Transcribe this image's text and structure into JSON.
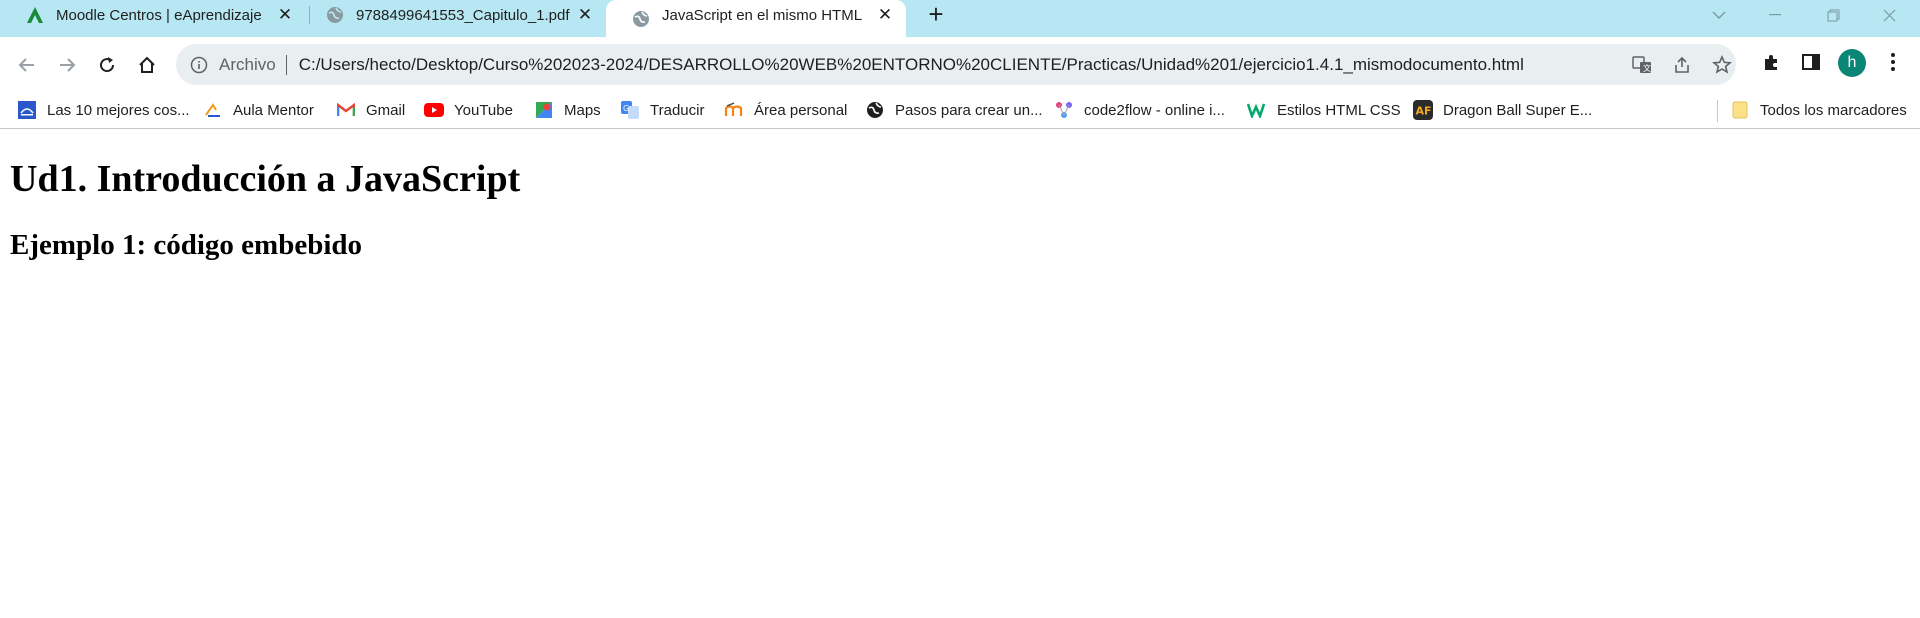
{
  "tabs": [
    {
      "title": "Moodle Centros | eAprendizaje",
      "icon": "moodle-icon"
    },
    {
      "title": "9788499641553_Capitulo_1.pdf",
      "icon": "globe-icon"
    },
    {
      "title": "JavaScript en el mismo HTML",
      "icon": "globe-icon",
      "active": true
    }
  ],
  "toolbar": {
    "scheme_label": "Archivo",
    "url": "C:/Users/hecto/Desktop/Curso%202023-2024/DESARROLLO%20WEB%20ENTORNO%20CLIENTE/Practicas/Unidad%201/ejercicio1.4.1_mismodocumento.html",
    "avatar_letter": "h"
  },
  "bookmarks": [
    {
      "label": "Las 10 mejores cos...",
      "icon": "bookmark-site-icon"
    },
    {
      "label": "Aula Mentor",
      "icon": "aula-mentor-icon"
    },
    {
      "label": "Gmail",
      "icon": "gmail-icon"
    },
    {
      "label": "YouTube",
      "icon": "youtube-icon"
    },
    {
      "label": "Maps",
      "icon": "maps-icon"
    },
    {
      "label": "Traducir",
      "icon": "translate-icon"
    },
    {
      "label": "Área personal",
      "icon": "moodle-m-icon"
    },
    {
      "label": "Pasos para crear un...",
      "icon": "globe-icon"
    },
    {
      "label": "code2flow - online i...",
      "icon": "code2flow-icon"
    },
    {
      "label": "Estilos HTML CSS",
      "icon": "w3schools-icon"
    },
    {
      "label": "Dragon Ball Super E...",
      "icon": "af-icon"
    }
  ],
  "all_bookmarks_label": "Todos los marcadores",
  "page": {
    "heading": "Ud1. Introducción a JavaScript",
    "subheading": "Ejemplo 1: código embebido"
  },
  "colors": {
    "tabstrip": "#b7e7f2",
    "avatar": "#0b8576",
    "youtube": "#ff0000"
  }
}
